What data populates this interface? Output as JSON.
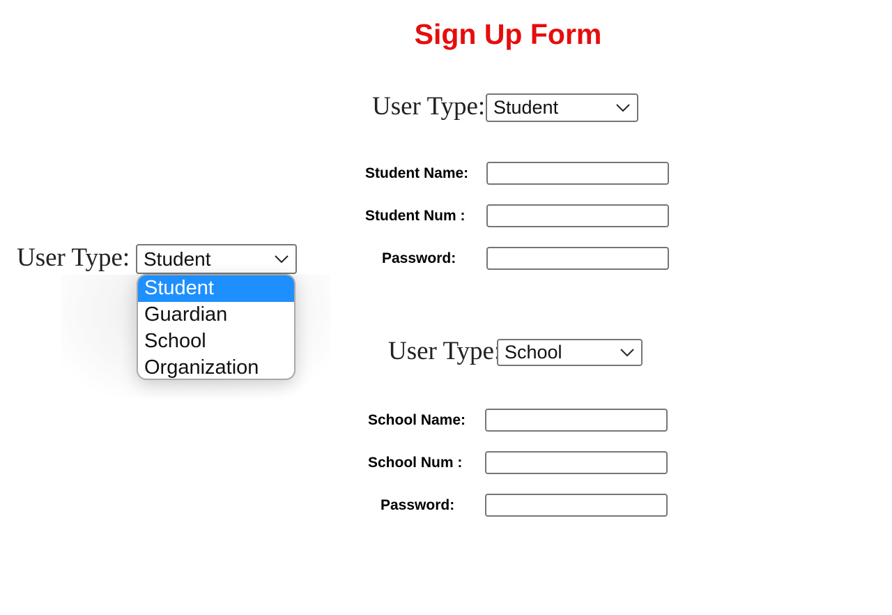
{
  "page": {
    "title": "Sign Up Form",
    "title_color": "#e60d0d"
  },
  "dropdown_demo": {
    "label": "User Type:",
    "selected": "Student",
    "options": [
      "Student",
      "Guardian",
      "School",
      "Organization"
    ],
    "highlight_color": "#1e8fff"
  },
  "student_form": {
    "user_type_label": "User Type:",
    "user_type_value": "Student",
    "fields": [
      {
        "label": "Student Name:",
        "value": ""
      },
      {
        "label": "Student Num :",
        "value": ""
      },
      {
        "label": "Password:",
        "value": ""
      }
    ]
  },
  "school_form": {
    "user_type_label": "User Type:",
    "user_type_value": "School",
    "fields": [
      {
        "label": "School Name:",
        "value": ""
      },
      {
        "label": "School Num :",
        "value": ""
      },
      {
        "label": "Password:",
        "value": ""
      }
    ]
  }
}
